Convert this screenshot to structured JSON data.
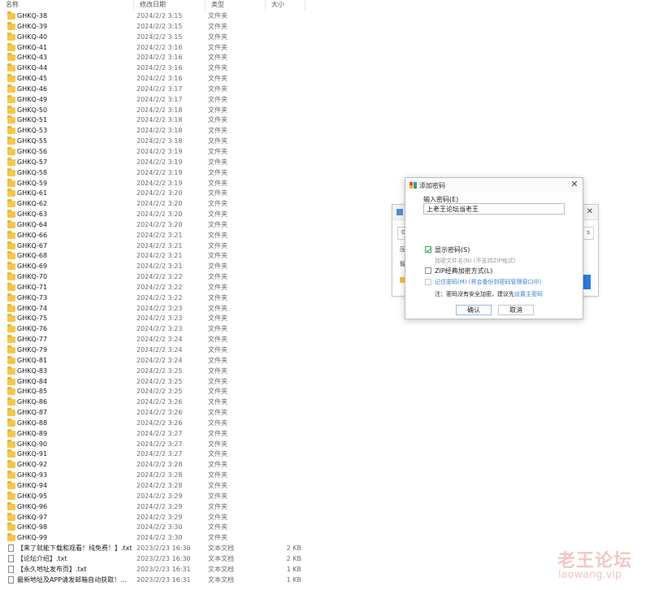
{
  "columns": {
    "name": "名称",
    "date": "修改日期",
    "type": "类型",
    "size": "大小"
  },
  "files": [
    {
      "name": "GHKQ-38",
      "date": "2024/2/2 3:15",
      "type": "文件夹",
      "size": "",
      "kind": "folder"
    },
    {
      "name": "GHKQ-39",
      "date": "2024/2/2 3:15",
      "type": "文件夹",
      "size": "",
      "kind": "folder"
    },
    {
      "name": "GHKQ-40",
      "date": "2024/2/2 3:15",
      "type": "文件夹",
      "size": "",
      "kind": "folder"
    },
    {
      "name": "GHKQ-41",
      "date": "2024/2/2 3:16",
      "type": "文件夹",
      "size": "",
      "kind": "folder"
    },
    {
      "name": "GHKQ-43",
      "date": "2024/2/2 3:16",
      "type": "文件夹",
      "size": "",
      "kind": "folder"
    },
    {
      "name": "GHKQ-44",
      "date": "2024/2/2 3:16",
      "type": "文件夹",
      "size": "",
      "kind": "folder"
    },
    {
      "name": "GHKQ-45",
      "date": "2024/2/2 3:16",
      "type": "文件夹",
      "size": "",
      "kind": "folder"
    },
    {
      "name": "GHKQ-46",
      "date": "2024/2/2 3:17",
      "type": "文件夹",
      "size": "",
      "kind": "folder"
    },
    {
      "name": "GHKQ-49",
      "date": "2024/2/2 3:17",
      "type": "文件夹",
      "size": "",
      "kind": "folder"
    },
    {
      "name": "GHKQ-50",
      "date": "2024/2/2 3:18",
      "type": "文件夹",
      "size": "",
      "kind": "folder"
    },
    {
      "name": "GHKQ-51",
      "date": "2024/2/2 3:18",
      "type": "文件夹",
      "size": "",
      "kind": "folder"
    },
    {
      "name": "GHKQ-53",
      "date": "2024/2/2 3:18",
      "type": "文件夹",
      "size": "",
      "kind": "folder"
    },
    {
      "name": "GHKQ-55",
      "date": "2024/2/2 3:18",
      "type": "文件夹",
      "size": "",
      "kind": "folder"
    },
    {
      "name": "GHKQ-56",
      "date": "2024/2/2 3:19",
      "type": "文件夹",
      "size": "",
      "kind": "folder"
    },
    {
      "name": "GHKQ-57",
      "date": "2024/2/2 3:19",
      "type": "文件夹",
      "size": "",
      "kind": "folder"
    },
    {
      "name": "GHKQ-58",
      "date": "2024/2/2 3:19",
      "type": "文件夹",
      "size": "",
      "kind": "folder"
    },
    {
      "name": "GHKQ-59",
      "date": "2024/2/2 3:19",
      "type": "文件夹",
      "size": "",
      "kind": "folder"
    },
    {
      "name": "GHKQ-61",
      "date": "2024/2/2 3:20",
      "type": "文件夹",
      "size": "",
      "kind": "folder"
    },
    {
      "name": "GHKQ-62",
      "date": "2024/2/2 3:20",
      "type": "文件夹",
      "size": "",
      "kind": "folder"
    },
    {
      "name": "GHKQ-63",
      "date": "2024/2/2 3:20",
      "type": "文件夹",
      "size": "",
      "kind": "folder"
    },
    {
      "name": "GHKQ-64",
      "date": "2024/2/2 3:20",
      "type": "文件夹",
      "size": "",
      "kind": "folder"
    },
    {
      "name": "GHKQ-66",
      "date": "2024/2/2 3:21",
      "type": "文件夹",
      "size": "",
      "kind": "folder"
    },
    {
      "name": "GHKQ-67",
      "date": "2024/2/2 3:21",
      "type": "文件夹",
      "size": "",
      "kind": "folder"
    },
    {
      "name": "GHKQ-68",
      "date": "2024/2/2 3:21",
      "type": "文件夹",
      "size": "",
      "kind": "folder"
    },
    {
      "name": "GHKQ-69",
      "date": "2024/2/2 3:21",
      "type": "文件夹",
      "size": "",
      "kind": "folder"
    },
    {
      "name": "GHKQ-70",
      "date": "2024/2/2 3:22",
      "type": "文件夹",
      "size": "",
      "kind": "folder"
    },
    {
      "name": "GHKQ-71",
      "date": "2024/2/2 3:22",
      "type": "文件夹",
      "size": "",
      "kind": "folder"
    },
    {
      "name": "GHKQ-73",
      "date": "2024/2/2 3:22",
      "type": "文件夹",
      "size": "",
      "kind": "folder"
    },
    {
      "name": "GHKQ-74",
      "date": "2024/2/2 3:23",
      "type": "文件夹",
      "size": "",
      "kind": "folder"
    },
    {
      "name": "GHKQ-75",
      "date": "2024/2/2 3:23",
      "type": "文件夹",
      "size": "",
      "kind": "folder"
    },
    {
      "name": "GHKQ-76",
      "date": "2024/2/2 3:23",
      "type": "文件夹",
      "size": "",
      "kind": "folder"
    },
    {
      "name": "GHKQ-77",
      "date": "2024/2/2 3:24",
      "type": "文件夹",
      "size": "",
      "kind": "folder"
    },
    {
      "name": "GHKQ-79",
      "date": "2024/2/2 3:24",
      "type": "文件夹",
      "size": "",
      "kind": "folder"
    },
    {
      "name": "GHKQ-81",
      "date": "2024/2/2 3:24",
      "type": "文件夹",
      "size": "",
      "kind": "folder"
    },
    {
      "name": "GHKQ-83",
      "date": "2024/2/2 3:25",
      "type": "文件夹",
      "size": "",
      "kind": "folder"
    },
    {
      "name": "GHKQ-84",
      "date": "2024/2/2 3:25",
      "type": "文件夹",
      "size": "",
      "kind": "folder"
    },
    {
      "name": "GHKQ-85",
      "date": "2024/2/2 3:25",
      "type": "文件夹",
      "size": "",
      "kind": "folder"
    },
    {
      "name": "GHKQ-86",
      "date": "2024/2/2 3:26",
      "type": "文件夹",
      "size": "",
      "kind": "folder"
    },
    {
      "name": "GHKQ-87",
      "date": "2024/2/2 3:26",
      "type": "文件夹",
      "size": "",
      "kind": "folder"
    },
    {
      "name": "GHKQ-88",
      "date": "2024/2/2 3:26",
      "type": "文件夹",
      "size": "",
      "kind": "folder"
    },
    {
      "name": "GHKQ-89",
      "date": "2024/2/2 3:27",
      "type": "文件夹",
      "size": "",
      "kind": "folder"
    },
    {
      "name": "GHKQ-90",
      "date": "2024/2/2 3:27",
      "type": "文件夹",
      "size": "",
      "kind": "folder"
    },
    {
      "name": "GHKQ-91",
      "date": "2024/2/2 3:27",
      "type": "文件夹",
      "size": "",
      "kind": "folder"
    },
    {
      "name": "GHKQ-92",
      "date": "2024/2/2 3:28",
      "type": "文件夹",
      "size": "",
      "kind": "folder"
    },
    {
      "name": "GHKQ-93",
      "date": "2024/2/2 3:28",
      "type": "文件夹",
      "size": "",
      "kind": "folder"
    },
    {
      "name": "GHKQ-94",
      "date": "2024/2/2 3:28",
      "type": "文件夹",
      "size": "",
      "kind": "folder"
    },
    {
      "name": "GHKQ-95",
      "date": "2024/2/2 3:29",
      "type": "文件夹",
      "size": "",
      "kind": "folder"
    },
    {
      "name": "GHKQ-96",
      "date": "2024/2/2 3:29",
      "type": "文件夹",
      "size": "",
      "kind": "folder"
    },
    {
      "name": "GHKQ-97",
      "date": "2024/2/2 3:29",
      "type": "文件夹",
      "size": "",
      "kind": "folder"
    },
    {
      "name": "GHKQ-98",
      "date": "2024/2/2 3:30",
      "type": "文件夹",
      "size": "",
      "kind": "folder"
    },
    {
      "name": "GHKQ-99",
      "date": "2024/2/2 3:30",
      "type": "文件夹",
      "size": "",
      "kind": "folder"
    },
    {
      "name": "【来了就能下载和观看！纯免费！】.txt",
      "date": "2023/2/23 16:30",
      "type": "文本文档",
      "size": "2 KB",
      "kind": "text"
    },
    {
      "name": "【论坛介绍】.txt",
      "date": "2023/2/23 16:30",
      "type": "文本文档",
      "size": "2 KB",
      "kind": "text"
    },
    {
      "name": "【永久地址发布页】.txt",
      "date": "2023/2/23 16:31",
      "type": "文本文档",
      "size": "1 KB",
      "kind": "text"
    },
    {
      "name": "最新地址及APP请发邮箱自动获取！！！....",
      "date": "2023/2/23 16:31",
      "type": "文本文档",
      "size": "1 KB",
      "kind": "text"
    }
  ],
  "dialog": {
    "title": "添加密码",
    "close": "✕",
    "input_label": "输入密码(E)",
    "password_value": "上老王论坛当老王",
    "show_password": "显示密码(S)",
    "encrypt_names": "加密文件名(N) (不支持ZIP格式)",
    "zip_classic": "ZIP经典加密方式(L)",
    "remember": "记住密码(M) (将会备份到密码管理窗口中)",
    "note_prefix": "注：密码没有安全加密，建议先",
    "note_link": "设置主密码",
    "ok": "确认",
    "cancel": "取消"
  },
  "bg_dialog": {
    "close": "✕",
    "g_char": "G",
    "s_char": "s",
    "ya_char": "压",
    "zhi_char": "智"
  },
  "watermark": {
    "text": "老王论坛",
    "url": "laowang.vip"
  },
  "colors": {
    "accent": "#3b82d6",
    "check": "#3aa757",
    "folder": "#f3c74d"
  }
}
